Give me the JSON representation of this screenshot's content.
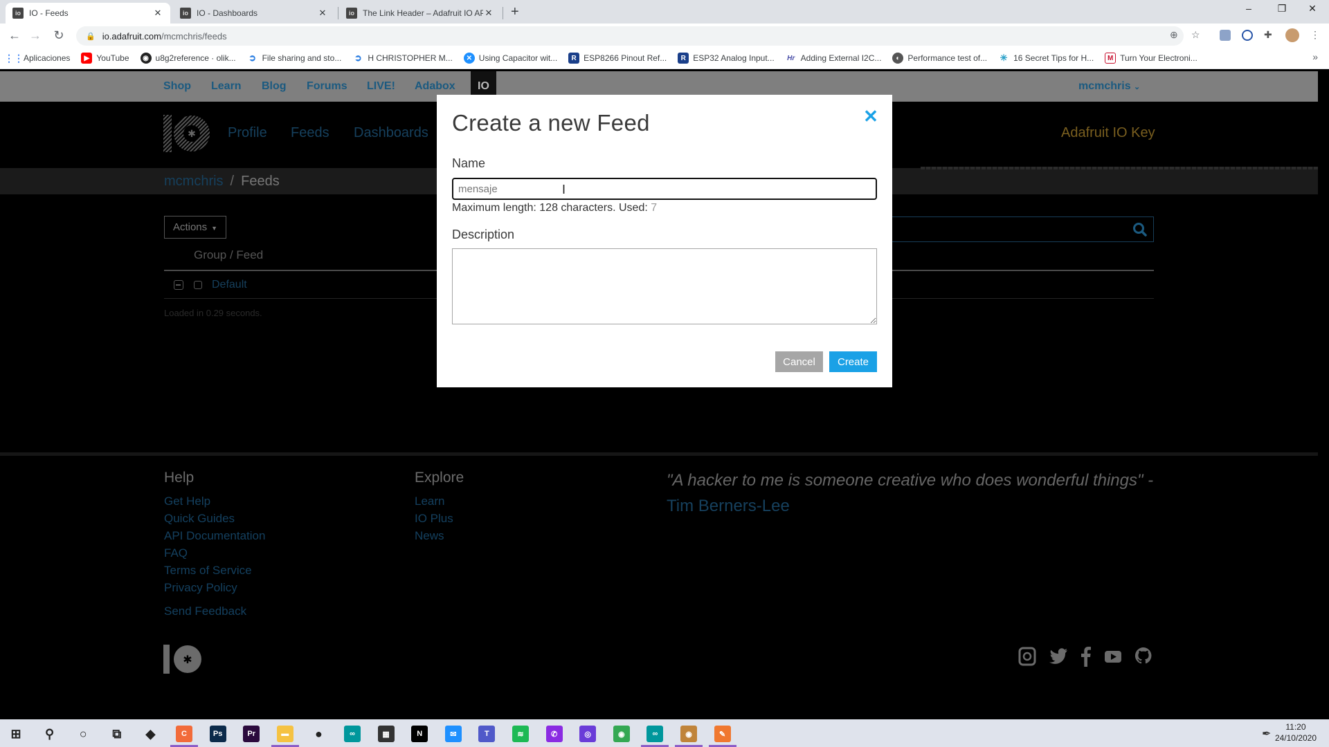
{
  "browser": {
    "tabs": [
      {
        "title": "IO - Feeds",
        "active": true
      },
      {
        "title": "IO - Dashboards",
        "active": false
      },
      {
        "title": "The Link Header – Adafruit IO AP",
        "active": false
      }
    ],
    "new_tab": "+",
    "window_controls": {
      "minimize": "–",
      "restore": "❐",
      "close": "✕"
    },
    "url": "io.adafruit.com/mcmchris/feeds",
    "url_host": "io.adafruit.com",
    "url_path": "/mcmchris/feeds",
    "bookmarks": [
      {
        "label": "Aplicaciones",
        "icon": "apps-grid-icon",
        "color": "#4285f4"
      },
      {
        "label": "YouTube",
        "icon": "youtube-icon",
        "color": "#ff0000"
      },
      {
        "label": "u8g2reference · olik...",
        "icon": "github-icon",
        "color": "#222222"
      },
      {
        "label": "File sharing and sto...",
        "icon": "share-icon",
        "color": "#2a7de1"
      },
      {
        "label": "H CHRISTOPHER M...",
        "icon": "share-icon",
        "color": "#2a7de1"
      },
      {
        "label": "Using Capacitor wit...",
        "icon": "capacitor-icon",
        "color": "#1e90ff"
      },
      {
        "label": "ESP8266 Pinout Ref...",
        "icon": "r-icon",
        "color": "#1a3f8a"
      },
      {
        "label": "ESP32 Analog Input...",
        "icon": "r-icon",
        "color": "#1a3f8a"
      },
      {
        "label": "Adding External I2C...",
        "icon": "h-icon",
        "color": "#4a4fa8"
      },
      {
        "label": "Performance test of...",
        "icon": "globe-icon",
        "color": "#555555"
      },
      {
        "label": "16 Secret Tips for H...",
        "icon": "sparkle-icon",
        "color": "#2aa0c8"
      },
      {
        "label": "Turn Your Electroni...",
        "icon": "m-icon",
        "color": "#c8102e"
      }
    ],
    "bookmarks_more": "»"
  },
  "site": {
    "top_nav": [
      "Shop",
      "Learn",
      "Blog",
      "Forums",
      "LIVE!",
      "Adabox"
    ],
    "io_tab": "IO",
    "user_menu": "mcmchris",
    "io_nav": [
      "Profile",
      "Feeds",
      "Dashboards"
    ],
    "io_key": "Adafruit IO Key",
    "breadcrumb": {
      "user": "mcmchris",
      "separator": "/",
      "current": "Feeds"
    },
    "actions_label": "Actions",
    "table": {
      "column_header": "Group / Feed",
      "rows": [
        {
          "name": "Default"
        }
      ]
    },
    "loaded_text": "Loaded in 0.29 seconds.",
    "footer": {
      "help_heading": "Help",
      "help_links": [
        "Get Help",
        "Quick Guides",
        "API Documentation",
        "FAQ",
        "Terms of Service",
        "Privacy Policy"
      ],
      "send_feedback": "Send Feedback",
      "explore_heading": "Explore",
      "explore_links": [
        "Learn",
        "IO Plus",
        "News"
      ],
      "quote_text": "\"A hacker to me is someone creative who does wonderful things\" - ",
      "quote_author": "Tim Berners-Lee",
      "social": [
        "instagram",
        "twitter",
        "facebook",
        "youtube",
        "github"
      ]
    }
  },
  "modal": {
    "title": "Create a new Feed",
    "close": "✕",
    "name_label": "Name",
    "name_value": "mensaje",
    "maxlen_text": "Maximum length: 128 characters. Used: ",
    "used_count": "7",
    "description_label": "Description",
    "description_value": "",
    "cancel_label": "Cancel",
    "create_label": "Create"
  },
  "colors": {
    "accent": "#1aa1e6",
    "cancel": "#a6a6a6",
    "link_dim": "#16405d",
    "io_key": "#7a5f1f"
  },
  "taskbar": {
    "apps": [
      {
        "name": "start",
        "label": "⊞",
        "bg": "transparent"
      },
      {
        "name": "search",
        "label": "⚲",
        "bg": "transparent"
      },
      {
        "name": "cortana",
        "label": "○",
        "bg": "transparent"
      },
      {
        "name": "task-view",
        "label": "⧉",
        "bg": "transparent"
      },
      {
        "name": "app-3d",
        "label": "◆",
        "bg": "transparent"
      },
      {
        "name": "clip-studio",
        "label": "C",
        "bg": "#f26b3a"
      },
      {
        "name": "photoshop",
        "label": "Ps",
        "bg": "#0b2a4a"
      },
      {
        "name": "premiere",
        "label": "Pr",
        "bg": "#2b0a3d"
      },
      {
        "name": "file-explorer",
        "label": "▬",
        "bg": "#f5c242"
      },
      {
        "name": "app-red",
        "label": "●",
        "bg": "transparent"
      },
      {
        "name": "arduino",
        "label": "∞",
        "bg": "#00979c"
      },
      {
        "name": "store",
        "label": "▦",
        "bg": "#333333"
      },
      {
        "name": "netflix",
        "label": "N",
        "bg": "#000000"
      },
      {
        "name": "mail",
        "label": "✉",
        "bg": "#1e90ff"
      },
      {
        "name": "teams",
        "label": "T",
        "bg": "#5059c9"
      },
      {
        "name": "spotify",
        "label": "≋",
        "bg": "#1db954"
      },
      {
        "name": "whatsapp",
        "label": "✆",
        "bg": "#8a2be2"
      },
      {
        "name": "app-purple",
        "label": "◎",
        "bg": "#6a3cd8"
      },
      {
        "name": "chrome",
        "label": "◉",
        "bg": "#34a853"
      },
      {
        "name": "arduino-2",
        "label": "∞",
        "bg": "#00979c"
      },
      {
        "name": "chrome-profile",
        "label": "◉",
        "bg": "#c0843a"
      },
      {
        "name": "sketch",
        "label": "✎",
        "bg": "#f07830"
      }
    ],
    "time": "11:20",
    "date": "24/10/2020"
  }
}
